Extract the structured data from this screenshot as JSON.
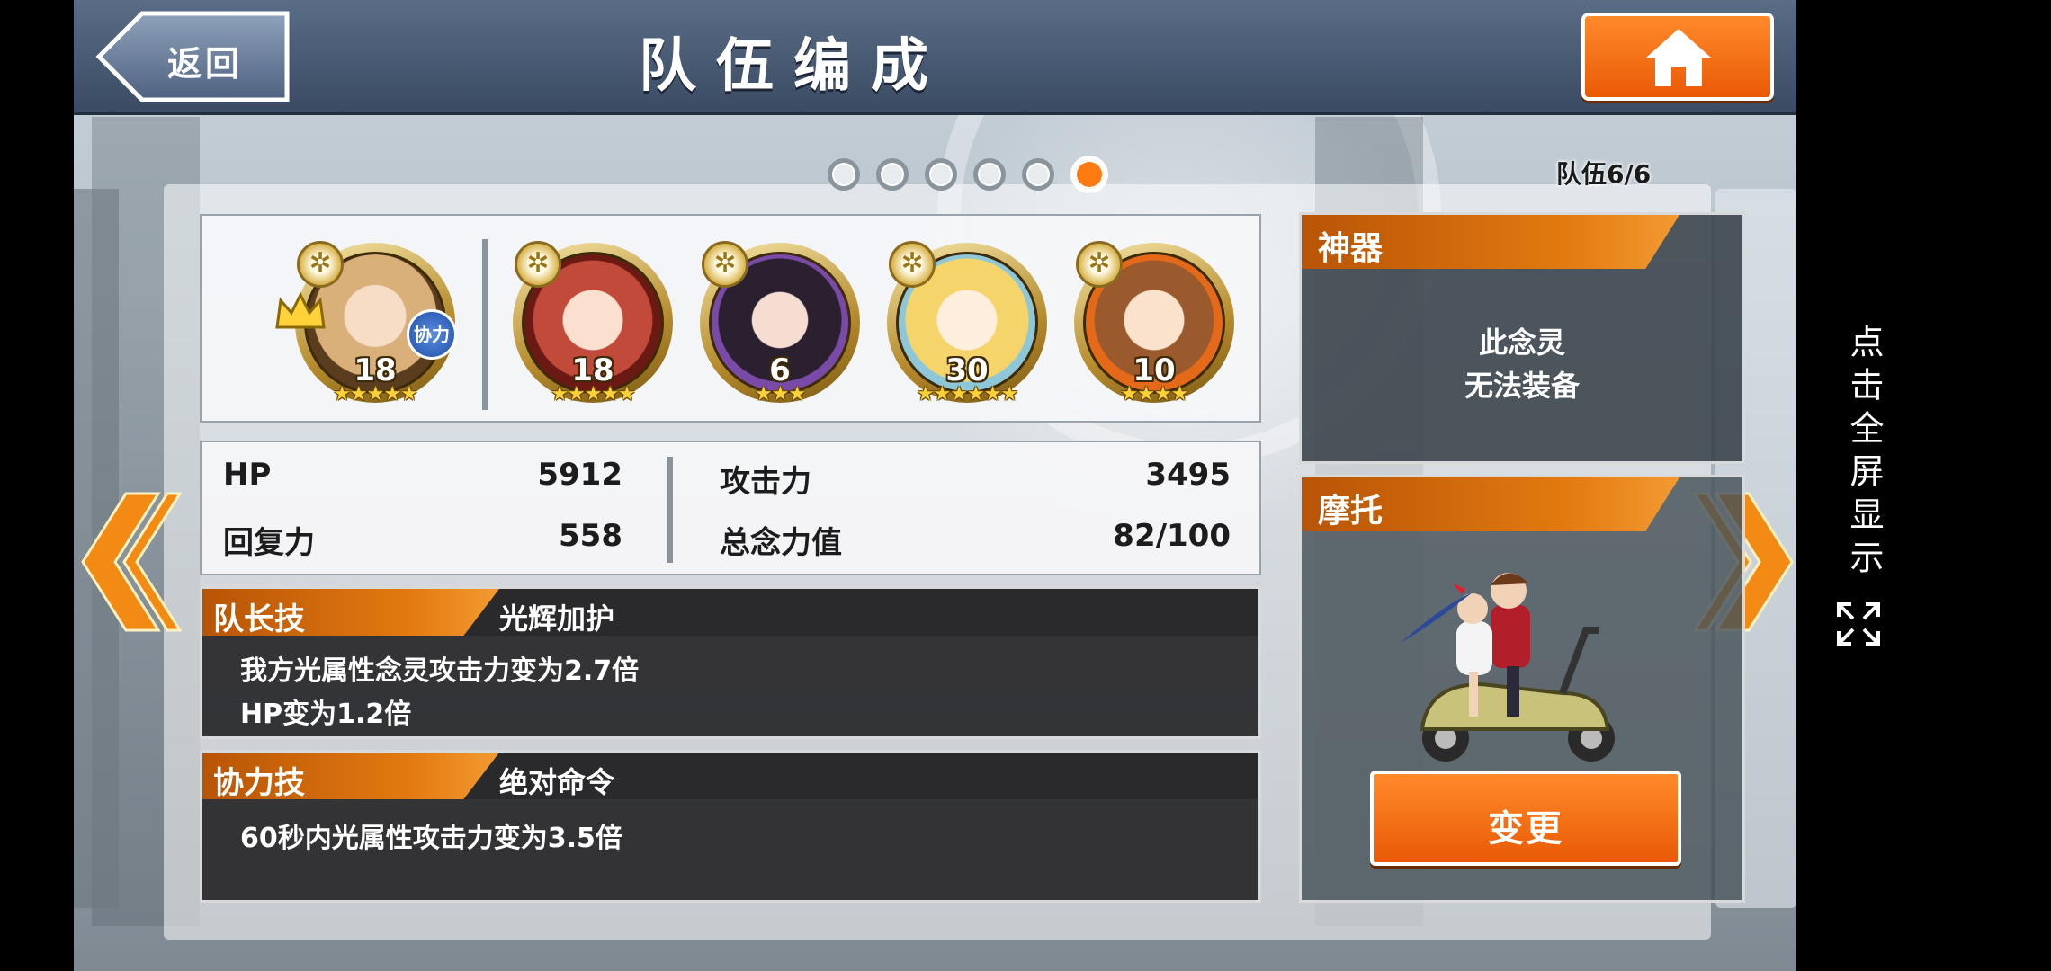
{
  "header": {
    "back_label": "返回",
    "title": "队伍编成",
    "home_icon": "home-icon"
  },
  "pager": {
    "total": 6,
    "current": 6,
    "team_counter": "队伍6/6"
  },
  "team": [
    {
      "level": "18",
      "stars": "★★★★★",
      "leader": true,
      "coop_badge": "协力"
    },
    {
      "level": "18",
      "stars": "★★★★★"
    },
    {
      "level": "6",
      "stars": "★★★"
    },
    {
      "level": "30",
      "stars": "★★★★★★"
    },
    {
      "level": "10",
      "stars": "★★★★"
    }
  ],
  "stats": {
    "hp_label": "HP",
    "hp_value": "5912",
    "recovery_label": "回复力",
    "recovery_value": "558",
    "attack_label": "攻击力",
    "attack_value": "3495",
    "power_label": "总念力值",
    "power_value": "82/100"
  },
  "leader_skill": {
    "tag": "队长技",
    "name": "光辉加护",
    "desc_line1": "我方光属性念灵攻击力变为2.7倍",
    "desc_line2": "HP变为1.2倍"
  },
  "coop_skill": {
    "tag": "协力技",
    "name": "绝对命令",
    "desc_line1": "60秒内光属性攻击力变为3.5倍"
  },
  "artifact": {
    "tag": "神器",
    "msg_line1": "此念灵",
    "msg_line2": "无法装备"
  },
  "motorbike": {
    "tag": "摩托",
    "change_label": "变更"
  },
  "fullscreen_hint": "点击全屏显示",
  "colors": {
    "accent_orange": "#e95a06",
    "header_blue": "#3a4b63",
    "star_gold": "#ffd23a"
  }
}
